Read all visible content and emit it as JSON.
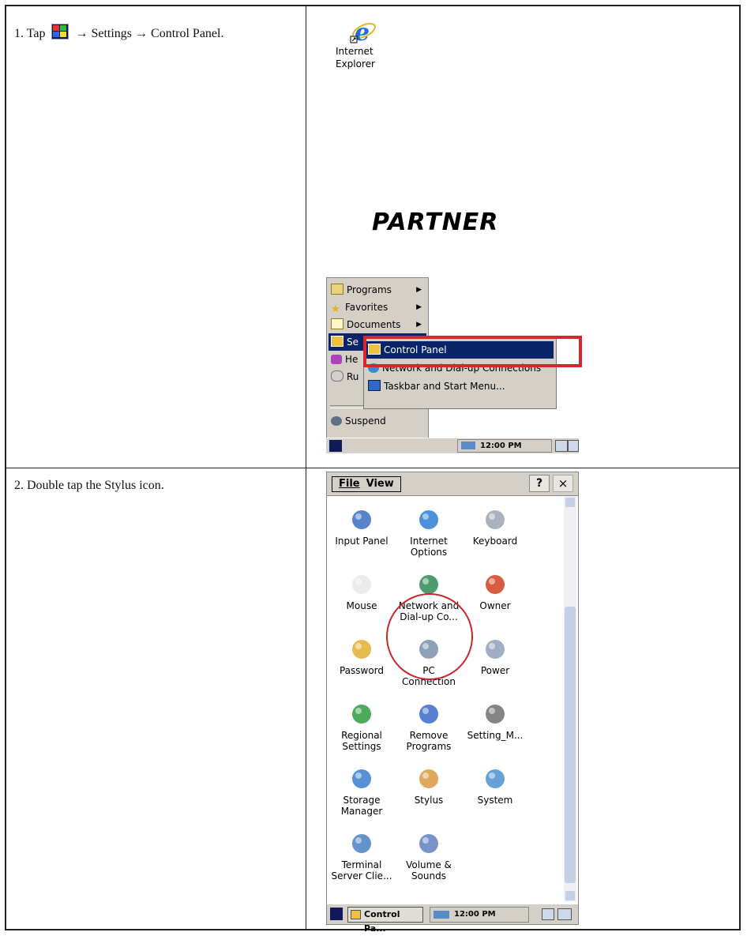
{
  "steps": [
    {
      "text_before": "1.  Tap ",
      "text_after": " → Settings → Control Panel."
    },
    {
      "text": "2.  Double tap the Stylus icon."
    }
  ],
  "shot1": {
    "desktop_icon": {
      "line1": "Internet",
      "line2": "Explorer",
      "icon": "internet-explorer-icon"
    },
    "logo_text": "PARTNER",
    "start_menu": [
      {
        "label": "Programs",
        "icon": "programs-folder-icon",
        "submenu": true
      },
      {
        "label": "Favorites",
        "icon": "favorites-star-icon",
        "submenu": true
      },
      {
        "label": "Documents",
        "icon": "documents-icon",
        "submenu": true
      },
      {
        "label": "Se",
        "icon": "settings-icon",
        "submenu": false,
        "selected": true
      },
      {
        "label": "He",
        "icon": "help-icon"
      },
      {
        "label": "Ru",
        "icon": "run-icon"
      },
      {
        "label": "Suspend",
        "icon": "suspend-icon"
      }
    ],
    "settings_submenu": [
      {
        "label": "Control Panel",
        "icon": "control-panel-icon",
        "selected": true
      },
      {
        "label": "Network and Dial-up Connections",
        "icon": "network-icon"
      },
      {
        "label": "Taskbar and Start Menu...",
        "icon": "taskbar-icon"
      }
    ],
    "clock": "12:00 PM"
  },
  "shot2": {
    "menu": {
      "file": "File",
      "view": "View"
    },
    "help_button": "?",
    "close_button": "×",
    "items": [
      {
        "line1": "Input Panel",
        "line2": "",
        "icon": "input-panel-icon",
        "color": "#3b6fbf"
      },
      {
        "line1": "Internet",
        "line2": "Options",
        "icon": "internet-options-icon",
        "color": "#2e7dd6"
      },
      {
        "line1": "Keyboard",
        "line2": "",
        "icon": "keyboard-icon",
        "color": "#9aa4b0"
      },
      {
        "line1": "Mouse",
        "line2": "",
        "icon": "mouse-icon",
        "color": "#e8e8e8"
      },
      {
        "line1": "Network and",
        "line2": "Dial-up Co...",
        "icon": "network-dialup-icon",
        "color": "#2e8b57"
      },
      {
        "line1": "Owner",
        "line2": "",
        "icon": "owner-icon",
        "color": "#d04020"
      },
      {
        "line1": "Password",
        "line2": "",
        "icon": "password-lock-icon",
        "color": "#e0b030"
      },
      {
        "line1": "PC",
        "line2": "Connection",
        "icon": "pc-connection-icon",
        "color": "#7a8fa8"
      },
      {
        "line1": "Power",
        "line2": "",
        "icon": "power-icon",
        "color": "#8fa0b8"
      },
      {
        "line1": "Regional",
        "line2": "Settings",
        "icon": "regional-settings-icon",
        "color": "#2f9a3f"
      },
      {
        "line1": "Remove",
        "line2": "Programs",
        "icon": "remove-programs-icon",
        "color": "#3a6ac8"
      },
      {
        "line1": "Setting_M...",
        "line2": "",
        "icon": "setting-gear-icon",
        "color": "#707070"
      },
      {
        "line1": "Storage",
        "line2": "Manager",
        "icon": "storage-manager-icon",
        "color": "#3b7ccf"
      },
      {
        "line1": "Stylus",
        "line2": "",
        "icon": "stylus-device-icon",
        "color": "#d89a40"
      },
      {
        "line1": "System",
        "line2": "",
        "icon": "system-icon",
        "color": "#4a90d0"
      },
      {
        "line1": "Terminal",
        "line2": "Server Clie...",
        "icon": "terminal-server-icon",
        "color": "#4a7fc0"
      },
      {
        "line1": "Volume &",
        "line2": "Sounds",
        "icon": "volume-sounds-icon",
        "color": "#6080c0"
      }
    ],
    "task_button": "Control Pa...",
    "clock": "12:00 PM"
  }
}
